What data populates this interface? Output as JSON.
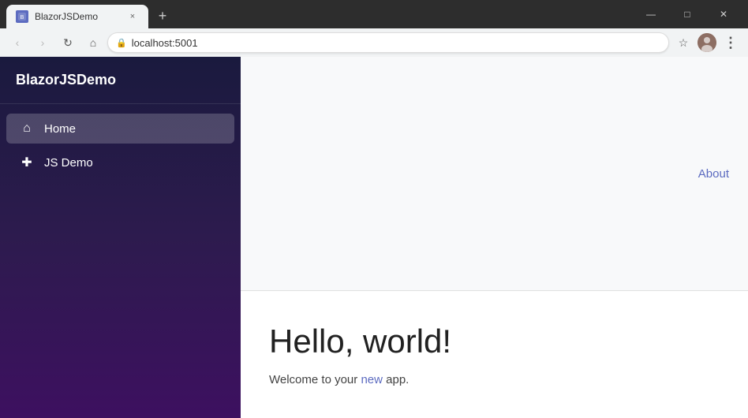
{
  "browser": {
    "tab": {
      "favicon_label": "B",
      "title": "BlazorJSDemo",
      "close_label": "×"
    },
    "new_tab_label": "+",
    "window_controls": {
      "minimize": "—",
      "maximize": "□",
      "close": "✕"
    },
    "address_bar": {
      "url": "localhost:5001",
      "lock_icon": "🔒",
      "star_icon": "☆",
      "menu_icon": "⋮"
    },
    "nav": {
      "back": "‹",
      "forward": "›",
      "refresh": "↻",
      "home": "⌂"
    }
  },
  "sidebar": {
    "app_title": "BlazorJSDemo",
    "nav_items": [
      {
        "id": "home",
        "label": "Home",
        "icon": "⌂",
        "active": true
      },
      {
        "id": "jsdemo",
        "label": "JS Demo",
        "icon": "✚",
        "active": false
      }
    ]
  },
  "topbar": {
    "about_label": "About"
  },
  "main": {
    "heading": "Hello, world!",
    "subtitle_before": "Welcome to your ",
    "subtitle_highlight": "new",
    "subtitle_after": " app."
  }
}
